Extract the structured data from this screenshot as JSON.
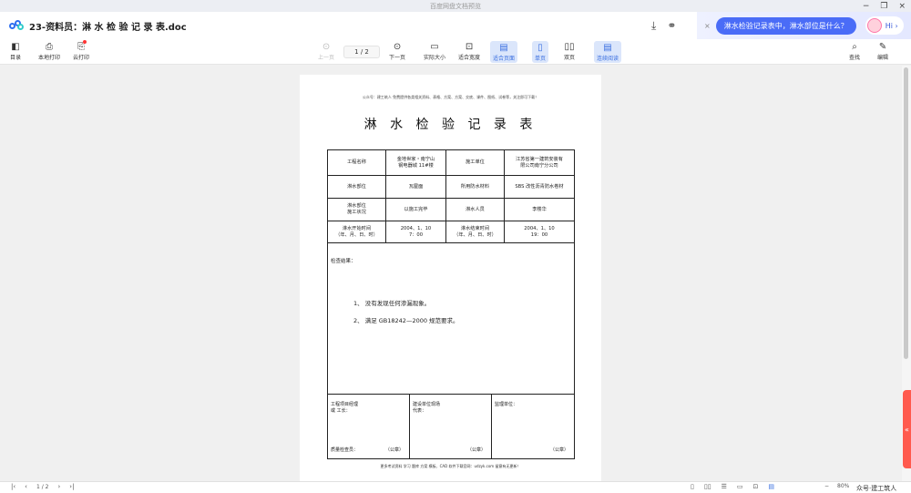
{
  "app": {
    "title": "百度网盘文档预览",
    "win_min": "−",
    "win_max": "❐",
    "win_close": "×"
  },
  "header": {
    "doc_title": "23-资料员：淋 水 检 验 记 录 表.doc",
    "download_icon": "⤓",
    "share_icon": "⚭"
  },
  "ai": {
    "close_icon": "×",
    "question": "淋水检验记录表中，淋水部位是什么？",
    "hi": "Hi ›"
  },
  "toolbar": {
    "catalog": {
      "icon": "◧",
      "label": "目录"
    },
    "local_print": {
      "icon": "⎙",
      "label": "本地打印"
    },
    "cloud_print": {
      "icon": "⎘",
      "label": "云打印"
    },
    "prev": {
      "icon": "⊙",
      "label": "上一页"
    },
    "page": "1 / 2",
    "next": {
      "icon": "⊙",
      "label": "下一页"
    },
    "actual": {
      "icon": "▭",
      "label": "实际大小"
    },
    "fit_width": {
      "icon": "⊡",
      "label": "适合宽度"
    },
    "fit_page": {
      "icon": "▤",
      "label": "适合页面"
    },
    "single": {
      "icon": "▯",
      "label": "单页"
    },
    "double": {
      "icon": "▯▯",
      "label": "双页"
    },
    "continuous": {
      "icon": "▤",
      "label": "连续阅读"
    },
    "search": {
      "icon": "⌕",
      "label": "查找"
    },
    "edit": {
      "icon": "✎",
      "label": "编辑"
    }
  },
  "document": {
    "top_note": "公众号：建工筑人  免费提供各类相关资料、表格、方案、方案、交底、课件、图纸、试卷等，关注即可下载！",
    "title": "淋 水 检 验 记 录 表",
    "rows": [
      [
        "工程名称",
        "金地世家・南宁山\n钢电器城 11#楼",
        "施工单位",
        "江苏省第一建筑安装有\n限公司南宁分公司"
      ],
      [
        "淋水部位",
        "瓦屋面",
        "所用防水材料",
        "SBS 改性沥青防水卷材"
      ],
      [
        "淋水部位\n施工状况",
        "以施工完毕",
        "淋水人员",
        "李楼华"
      ],
      [
        "淋水开始时间\n（年、月、日、时）",
        "2004、1、10\n7：00",
        "淋水结束时间\n（年、月、日、时）",
        "2004、1、10\n19：00"
      ]
    ],
    "check_label": "检查结果：",
    "items": [
      "1、    没有发现任何渗漏现象。",
      "2、    满足 GB18242—2000 规范要求。"
    ],
    "sign": [
      {
        "text": "工程项目经理\n或      工长：",
        "inspector": "质量检查员：",
        "stamp": "（公章）"
      },
      {
        "text": "建设单位现场\n代表：",
        "stamp": "（公章）"
      },
      {
        "text": "监理单位：",
        "stamp": "（公章）"
      }
    ],
    "bottom_note": "更多考试资料  学习  题库  方案  模板、CAD 软件下载官网：udzyk.com  留意有无更新！"
  },
  "side_tab": "«",
  "status": {
    "first": "|‹",
    "prev": "‹",
    "page": "1 / 2",
    "next": "›",
    "last": "›|",
    "icons": [
      "▯",
      "▯▯",
      "☰",
      "▭",
      "⊡",
      "▤"
    ],
    "zoom_minus": "−",
    "zoom": "80%",
    "zoom_plus": "+",
    "watermark": "众号·建工筑人"
  }
}
